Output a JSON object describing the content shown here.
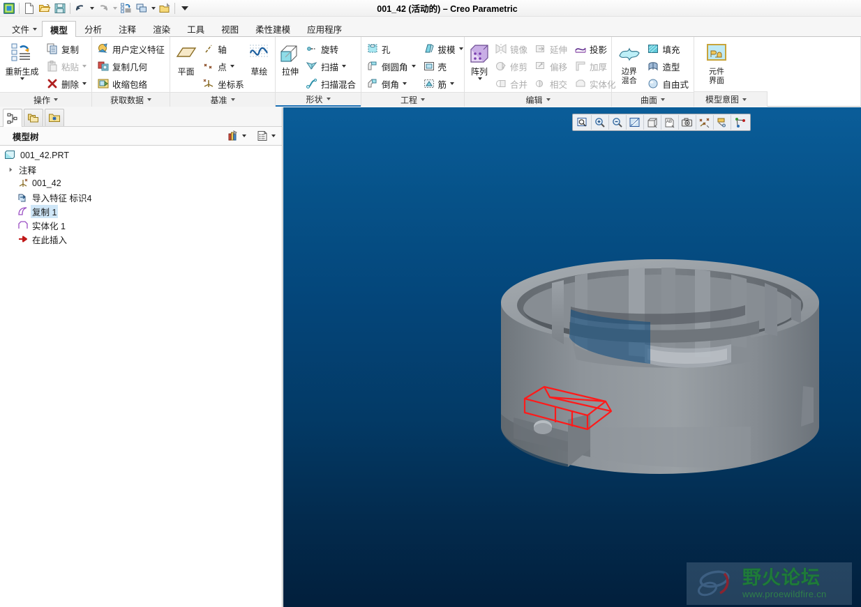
{
  "window": {
    "title": "001_42 (活动的) – Creo Parametric"
  },
  "quick_access": {
    "items": [
      {
        "name": "app-menu-icon",
        "label": "Creo"
      },
      {
        "name": "new-icon",
        "label": "新建"
      },
      {
        "name": "open-icon",
        "label": "打开"
      },
      {
        "name": "save-icon",
        "label": "保存"
      },
      {
        "name": "undo-icon",
        "label": "撤消"
      },
      {
        "name": "redo-icon",
        "label": "重做"
      },
      {
        "name": "regenerate-icon",
        "label": "重新生成"
      },
      {
        "name": "window-icon",
        "label": "窗口"
      },
      {
        "name": "close-window-icon",
        "label": "关闭"
      },
      {
        "name": "customize-qat-icon",
        "label": "自定义快速访问工具栏"
      }
    ]
  },
  "tabs": [
    {
      "label": "文件",
      "has_caret": true,
      "active": false
    },
    {
      "label": "模型",
      "has_caret": false,
      "active": true
    },
    {
      "label": "分析",
      "has_caret": false,
      "active": false
    },
    {
      "label": "注释",
      "has_caret": false,
      "active": false
    },
    {
      "label": "渲染",
      "has_caret": false,
      "active": false
    },
    {
      "label": "工具",
      "has_caret": false,
      "active": false
    },
    {
      "label": "视图",
      "has_caret": false,
      "active": false
    },
    {
      "label": "柔性建模",
      "has_caret": false,
      "active": false
    },
    {
      "label": "应用程序",
      "has_caret": false,
      "active": false
    }
  ],
  "ribbon": {
    "groups": [
      {
        "label": "操作",
        "big": {
          "label": "重新生成",
          "icon": "regenerate-icon",
          "has_caret": true
        },
        "items": [
          {
            "label": "复制",
            "icon": "copy-icon",
            "disabled": false,
            "caret": false
          },
          {
            "label": "粘贴",
            "icon": "paste-icon",
            "disabled": true,
            "caret": true
          },
          {
            "label": "删除",
            "icon": "delete-icon",
            "disabled": false,
            "caret": true
          }
        ]
      },
      {
        "label": "获取数据",
        "items": [
          {
            "label": "用户定义特征",
            "icon": "udf-icon",
            "disabled": false,
            "caret": false
          },
          {
            "label": "复制几何",
            "icon": "copy-geometry-icon",
            "disabled": false,
            "caret": false
          },
          {
            "label": "收缩包络",
            "icon": "shrinkwrap-icon",
            "disabled": false,
            "caret": false
          }
        ]
      },
      {
        "label": "基准",
        "big": {
          "label": "平面",
          "icon": "datum-plane-icon",
          "has_caret": false
        },
        "items": [
          {
            "label": "轴",
            "icon": "datum-axis-icon",
            "disabled": false,
            "caret": false
          },
          {
            "label": "点",
            "icon": "datum-point-icon",
            "disabled": false,
            "caret": true
          },
          {
            "label": "坐标系",
            "icon": "coordinate-system-icon",
            "disabled": false,
            "caret": false
          }
        ],
        "big2": {
          "label": "草绘",
          "icon": "sketch-icon",
          "has_caret": false
        }
      },
      {
        "label": "形状",
        "hover": true,
        "big": {
          "label": "拉伸",
          "icon": "extrude-icon",
          "has_caret": false
        },
        "items": [
          {
            "label": "旋转",
            "icon": "revolve-icon",
            "disabled": false,
            "caret": false
          },
          {
            "label": "扫描",
            "icon": "sweep-icon",
            "disabled": false,
            "caret": true
          },
          {
            "label": "扫描混合",
            "icon": "swept-blend-icon",
            "disabled": false,
            "caret": false
          }
        ]
      },
      {
        "label": "工程",
        "items": [
          {
            "label": "孔",
            "icon": "hole-icon",
            "disabled": false,
            "caret": false
          },
          {
            "label": "倒圆角",
            "icon": "round-icon",
            "disabled": false,
            "caret": true
          },
          {
            "label": "倒角",
            "icon": "chamfer-icon",
            "disabled": false,
            "caret": true
          }
        ],
        "items2": [
          {
            "label": "拔模",
            "icon": "draft-icon",
            "disabled": false,
            "caret": true
          },
          {
            "label": "壳",
            "icon": "shell-icon",
            "disabled": false,
            "caret": false
          },
          {
            "label": "筋",
            "icon": "rib-icon",
            "disabled": false,
            "caret": true
          }
        ]
      },
      {
        "label": "编辑",
        "big": {
          "label": "阵列",
          "icon": "pattern-icon",
          "has_caret": true
        },
        "items": [
          {
            "label": "镜像",
            "icon": "mirror-icon",
            "disabled": true,
            "caret": false
          },
          {
            "label": "修剪",
            "icon": "trim-icon",
            "disabled": true,
            "caret": false
          },
          {
            "label": "合并",
            "icon": "merge-icon",
            "disabled": true,
            "caret": false
          }
        ],
        "items2": [
          {
            "label": "延伸",
            "icon": "extend-icon",
            "disabled": true,
            "caret": false
          },
          {
            "label": "偏移",
            "icon": "offset-icon",
            "disabled": true,
            "caret": false
          },
          {
            "label": "相交",
            "icon": "intersect-icon",
            "disabled": true,
            "caret": false
          }
        ],
        "items3": [
          {
            "label": "投影",
            "icon": "project-icon",
            "disabled": false,
            "caret": false
          },
          {
            "label": "加厚",
            "icon": "thicken-icon",
            "disabled": true,
            "caret": false
          },
          {
            "label": "实体化",
            "icon": "solidify-icon",
            "disabled": true,
            "caret": false
          }
        ]
      },
      {
        "label": "曲面",
        "big": {
          "label": "边界\n混合",
          "icon": "boundary-blend-icon",
          "has_caret": false
        },
        "items": [
          {
            "label": "填充",
            "icon": "fill-icon",
            "disabled": false,
            "caret": false
          },
          {
            "label": "造型",
            "icon": "style-icon",
            "disabled": false,
            "caret": false
          },
          {
            "label": "自由式",
            "icon": "freestyle-icon",
            "disabled": false,
            "caret": false
          }
        ]
      },
      {
        "label": "模型意图",
        "big": {
          "label": "元件\n界面",
          "icon": "component-interface-icon",
          "has_caret": false
        },
        "items": []
      }
    ]
  },
  "left_panel": {
    "tabs": [
      {
        "name": "model-tree-tab",
        "label": "模型树",
        "active": true
      },
      {
        "name": "folder-browser-tab",
        "label": "文件夹浏览器",
        "active": false
      },
      {
        "name": "favorites-tab",
        "label": "收藏夹",
        "active": false
      }
    ],
    "header": {
      "title": "模型树",
      "settings_label": "设置",
      "display_label": "显示"
    },
    "tree": [
      {
        "label": "001_42.PRT",
        "icon": "part-icon",
        "indent": 0,
        "twist": "",
        "selected": false
      },
      {
        "label": "注释",
        "icon": "",
        "indent": 1,
        "twist": "collapsed",
        "selected": false
      },
      {
        "label": "001_42",
        "icon": "coordinate-system-icon",
        "indent": 1,
        "twist": "",
        "selected": false
      },
      {
        "label": "导入特征 标识4",
        "icon": "import-feature-icon",
        "indent": 1,
        "twist": "",
        "selected": false
      },
      {
        "label": "复制 1",
        "icon": "copy-surface-icon",
        "indent": 1,
        "twist": "",
        "selected": true
      },
      {
        "label": "实体化 1",
        "icon": "solidify-feature-icon",
        "indent": 1,
        "twist": "",
        "selected": false
      },
      {
        "label": "在此插入",
        "icon": "insert-here-icon",
        "indent": 1,
        "twist": "",
        "selected": false
      }
    ]
  },
  "graphics": {
    "toolbar": [
      {
        "name": "zoom-window-icon",
        "label": "放大区域"
      },
      {
        "name": "zoom-in-icon",
        "label": "放大"
      },
      {
        "name": "zoom-out-icon",
        "label": "缩小"
      },
      {
        "name": "refit-icon",
        "label": "重新调整"
      },
      {
        "name": "display-style-icon",
        "label": "显示样式"
      },
      {
        "name": "annotation-display-icon",
        "label": "注释显示"
      },
      {
        "name": "saved-view-icon",
        "label": "已保存视图"
      },
      {
        "name": "datum-display-icon",
        "label": "基准显示过滤器"
      },
      {
        "name": "layer-display-icon",
        "label": "层"
      },
      {
        "name": "point-display-icon",
        "label": "点显示"
      }
    ],
    "background_top_color": "#0a5d99",
    "background_bottom_color": "#021f3c",
    "model_color": "#8d9399",
    "highlight_color": "#ff0000"
  },
  "watermark": {
    "title": "野火论坛",
    "url": "www.proewildfire.cn"
  }
}
